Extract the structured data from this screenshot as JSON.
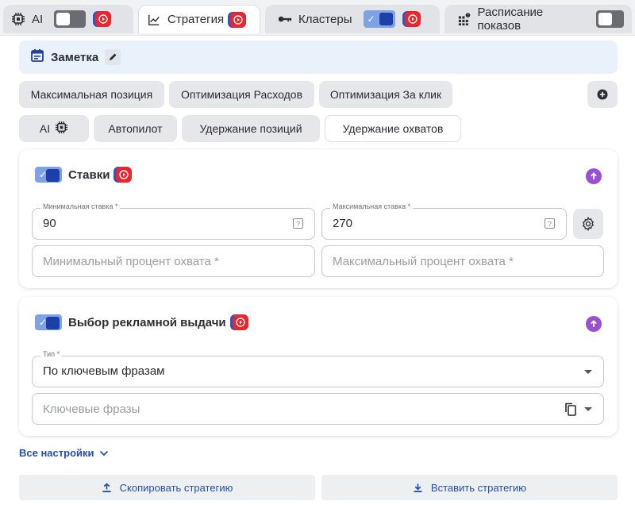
{
  "tabs": [
    {
      "label": "AI",
      "icon": "chip-icon"
    },
    {
      "label": "Стратегия",
      "icon": "chart-line-icon"
    },
    {
      "label": "Кластеры",
      "icon": "key-icon"
    },
    {
      "label": "Расписание показов",
      "icon": "grid-icon"
    }
  ],
  "note": {
    "label": "Заметка"
  },
  "strategy_chips": [
    "Максимальная позиция",
    "Оптимизация Расходов",
    "Оптимизация За клик"
  ],
  "mode_chips": [
    "AI",
    "Автопилот",
    "Удержание позиций",
    "Удержание охватов"
  ],
  "bids": {
    "title": "Ставки",
    "min_bid": {
      "label": "Минимальная ставка *",
      "value": "90"
    },
    "max_bid": {
      "label": "Максимальная ставка *",
      "value": "270"
    },
    "min_reach_placeholder": "Минимальный процент охвата *",
    "max_reach_placeholder": "Максимальный процент охвата *"
  },
  "ad_selection": {
    "title": "Выбор рекламной выдачи",
    "type": {
      "label": "Тип *",
      "value": "По ключевым фразам"
    },
    "keywords_placeholder": "Ключевые фразы"
  },
  "all_settings": "Все настройки",
  "copy_strategy": "Скопировать стратегию",
  "paste_strategy": "Вставить стратегию",
  "colors": {
    "accent": "#1d3fa8",
    "youtube": "#e7262d",
    "purple": "#9b4fd4",
    "link": "#1f4fb4"
  }
}
